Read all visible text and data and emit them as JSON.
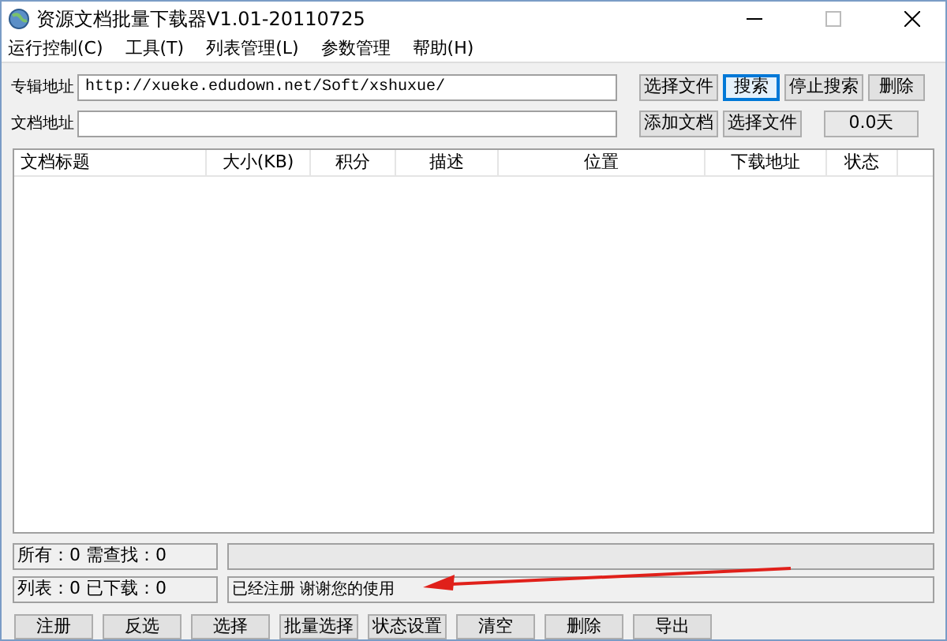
{
  "window": {
    "title": "资源文档批量下载器V1.01-20110725"
  },
  "menu": [
    "运行控制(C)",
    "工具(T)",
    "列表管理(L)",
    "参数管理",
    "帮助(H)"
  ],
  "album": {
    "label": "专辑地址",
    "value": "http://xueke.edudown.net/Soft/xshuxue/",
    "buttons": [
      {
        "label": "选择文件",
        "selected": false
      },
      {
        "label": "搜索",
        "selected": true
      },
      {
        "label": "停止搜索",
        "selected": false
      },
      {
        "label": "删除",
        "selected": false
      }
    ]
  },
  "doc": {
    "label": "文档地址",
    "buttons": [
      {
        "label": "添加文档",
        "selected": false
      },
      {
        "label": "选择文件",
        "selected": false
      }
    ],
    "days": "0.0天"
  },
  "table": {
    "columns": [
      "文档标题",
      "大小(KB)",
      "积分",
      "描述",
      "位置",
      "下载地址",
      "状态"
    ]
  },
  "status": {
    "progress": {
      "level": 0
    },
    "counts1": "所有：0 需查找：0",
    "counts2": "列表：0 已下载：0",
    "message": "已经注册 谢谢您的使用"
  },
  "buttons": [
    "注册",
    "反选",
    "选择",
    "批量选择",
    "状态设置",
    "清空",
    "删除",
    "导出"
  ]
}
